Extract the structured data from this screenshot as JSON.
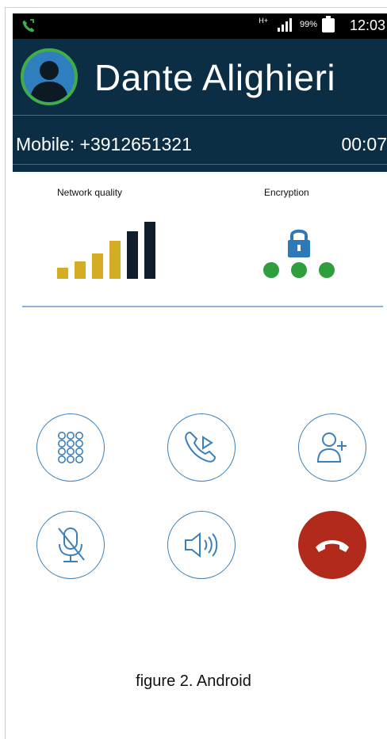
{
  "status_bar": {
    "network_type": "H+",
    "battery_percent": "99%",
    "time": "12:03"
  },
  "call": {
    "caller_name": "Dante Alighieri",
    "number_line": "Mobile: +3912651321",
    "duration": "00:07"
  },
  "indicators": {
    "network_quality_label": "Network quality",
    "network_quality_level": 5,
    "network_quality_max": 5,
    "encryption_label": "Encryption",
    "encryption_dots": 3
  },
  "colors": {
    "header_bg": "#0b2e44",
    "avatar_ring": "#3fae48",
    "avatar_bg": "#2f7fbf",
    "bar_gold": "#d4ad24",
    "bar_dark": "#0f1e2a",
    "lock_blue": "#2e79b7",
    "dot_green": "#2f9e3c",
    "button_outline": "#3d80b8",
    "hangup_red": "#b22a1b"
  },
  "buttons": [
    {
      "name": "keypad-button",
      "icon": "keypad-icon"
    },
    {
      "name": "transfer-call-button",
      "icon": "call-transfer-icon"
    },
    {
      "name": "add-participant-button",
      "icon": "add-user-icon"
    },
    {
      "name": "mute-button",
      "icon": "microphone-off-icon"
    },
    {
      "name": "speaker-button",
      "icon": "speaker-icon"
    },
    {
      "name": "hangup-button",
      "icon": "hangup-icon"
    }
  ],
  "caption": "figure 2. Android"
}
